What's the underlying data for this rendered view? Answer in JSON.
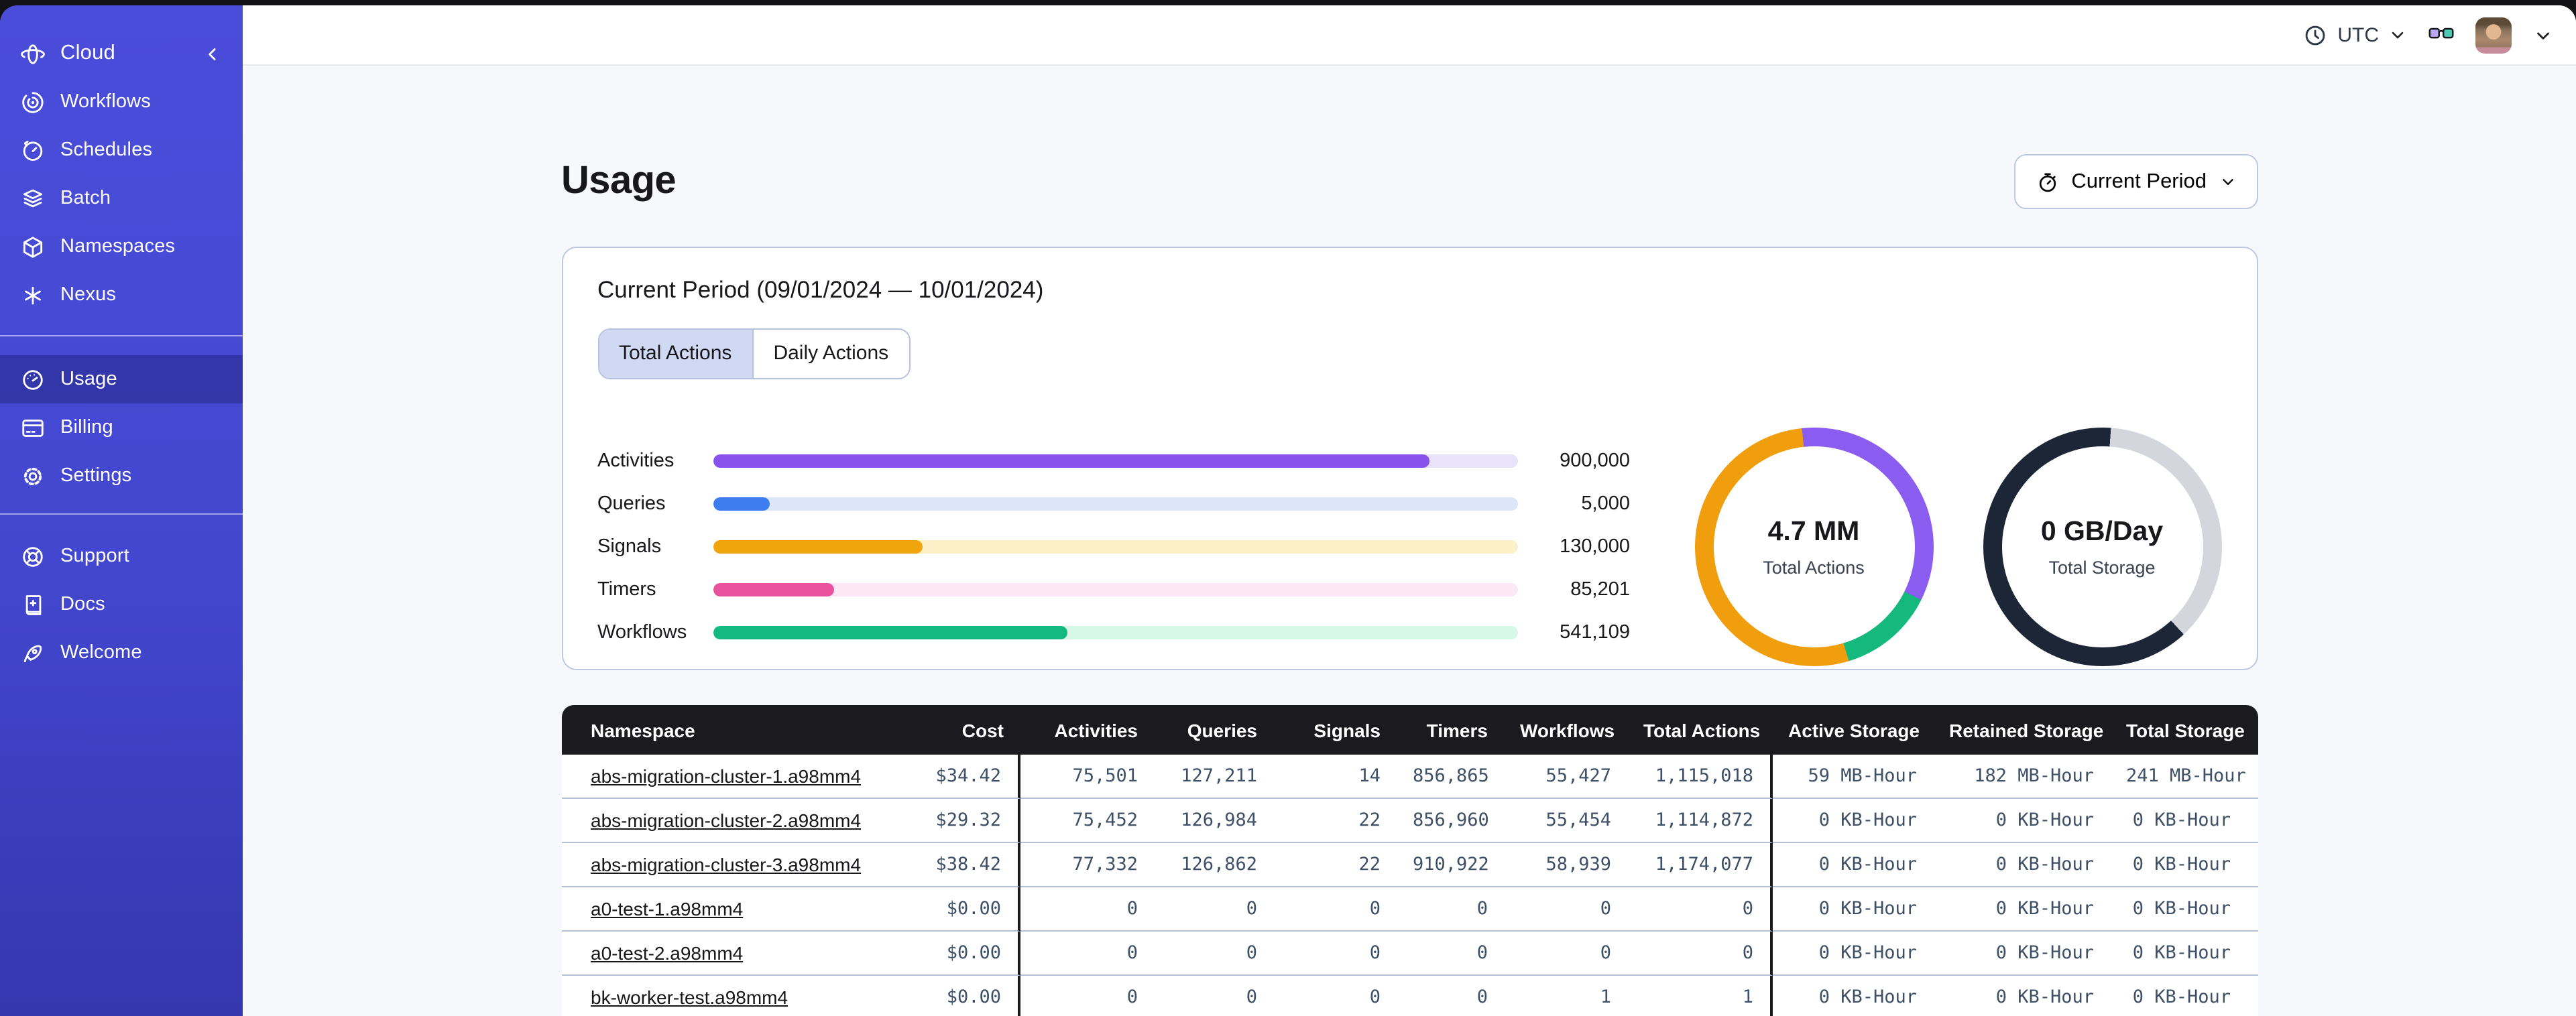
{
  "sidebar": {
    "groups": [
      {
        "divider": "none",
        "items": [
          {
            "icon": "cloud",
            "label": "Cloud",
            "trailing": "chevron-left",
            "active": false,
            "brand": true
          }
        ]
      },
      {
        "divider": "none",
        "items": [
          {
            "icon": "workflows",
            "label": "Workflows",
            "active": false
          },
          {
            "icon": "schedules",
            "label": "Schedules",
            "active": false
          },
          {
            "icon": "batch",
            "label": "Batch",
            "active": false
          },
          {
            "icon": "namespaces",
            "label": "Namespaces",
            "active": false
          },
          {
            "icon": "nexus",
            "label": "Nexus",
            "active": false
          }
        ]
      },
      {
        "divider": "line",
        "items": [
          {
            "icon": "usage",
            "label": "Usage",
            "active": true
          },
          {
            "icon": "billing",
            "label": "Billing",
            "active": false
          },
          {
            "icon": "settings",
            "label": "Settings",
            "active": false
          }
        ]
      },
      {
        "divider": "line",
        "items": [
          {
            "icon": "support",
            "label": "Support",
            "active": false
          },
          {
            "icon": "docs",
            "label": "Docs",
            "active": false
          },
          {
            "icon": "welcome",
            "label": "Welcome",
            "active": false
          }
        ]
      }
    ]
  },
  "topbar": {
    "timezone": "UTC"
  },
  "page": {
    "title": "Usage",
    "period_button_label": "Current Period"
  },
  "usage_card": {
    "title": "Current Period (09/01/2024 — 10/01/2024)",
    "tabs": [
      {
        "label": "Total Actions",
        "active": true
      },
      {
        "label": "Daily Actions",
        "active": false
      }
    ]
  },
  "chart_data": [
    {
      "type": "bar",
      "title": "Total Actions by type",
      "categories": [
        "Activities",
        "Queries",
        "Signals",
        "Timers",
        "Workflows"
      ],
      "values": [
        900000,
        5000,
        130000,
        85201,
        541109
      ],
      "value_labels": [
        "900,000",
        "5,000",
        "130,000",
        "85,201",
        "541,109"
      ],
      "fill_pct": [
        89,
        7,
        26,
        15,
        44
      ],
      "colors": [
        "#8952ef",
        "#3e7df0",
        "#f0a50c",
        "#e9509e",
        "#13b981"
      ],
      "track_colors": [
        "#e8e3fa",
        "#dbe6f9",
        "#fcf0c8",
        "#fbe7f6",
        "#d7f7e7"
      ],
      "legend": "none",
      "grid": "off"
    },
    {
      "type": "pie",
      "center_value": "4.7 MM",
      "center_label": "Total Actions",
      "start_deg": -6,
      "segments": [
        {
          "color": "#8b5cf0",
          "pct": 34
        },
        {
          "color": "#16b97d",
          "pct": 13
        },
        {
          "color": "#f09e0e",
          "pct": 53
        }
      ]
    },
    {
      "type": "pie",
      "center_value": "0 GB/Day",
      "center_label": "Total Storage",
      "start_deg": 4,
      "segments": [
        {
          "color": "#d3d6dd",
          "pct": 37
        },
        {
          "color": "#1c2636",
          "pct": 63
        }
      ]
    }
  ],
  "table": {
    "columns": [
      {
        "key": "namespace",
        "label": "Namespace",
        "align": "left",
        "group_end": false
      },
      {
        "key": "cost",
        "label": "Cost",
        "align": "right",
        "group_end": true
      },
      {
        "key": "activities",
        "label": "Activities",
        "align": "right",
        "group_end": false
      },
      {
        "key": "queries",
        "label": "Queries",
        "align": "right",
        "group_end": false
      },
      {
        "key": "signals",
        "label": "Signals",
        "align": "right",
        "group_end": false
      },
      {
        "key": "timers",
        "label": "Timers",
        "align": "right",
        "group_end": false
      },
      {
        "key": "workflows",
        "label": "Workflows",
        "align": "right",
        "group_end": false
      },
      {
        "key": "total_actions",
        "label": "Total Actions",
        "align": "right",
        "group_end": true
      },
      {
        "key": "active_storage",
        "label": "Active Storage",
        "align": "right",
        "group_end": false
      },
      {
        "key": "retained_storage",
        "label": "Retained Storage",
        "align": "right",
        "group_end": false
      },
      {
        "key": "total_storage",
        "label": "Total Storage",
        "align": "right",
        "group_end": false
      }
    ],
    "rows": [
      {
        "namespace": "abs-migration-cluster-1.a98mm4",
        "cost": "$34.42",
        "activities": "75,501",
        "queries": "127,211",
        "signals": "14",
        "timers": "856,865",
        "workflows": "55,427",
        "total_actions": "1,115,018",
        "active_storage": "59 MB-Hour",
        "retained_storage": "182 MB-Hour",
        "total_storage": "241 MB-Hour"
      },
      {
        "namespace": "abs-migration-cluster-2.a98mm4",
        "cost": "$29.32",
        "activities": "75,452",
        "queries": "126,984",
        "signals": "22",
        "timers": "856,960",
        "workflows": "55,454",
        "total_actions": "1,114,872",
        "active_storage": "0 KB-Hour",
        "retained_storage": "0 KB-Hour",
        "total_storage": "0 KB-Hour"
      },
      {
        "namespace": "abs-migration-cluster-3.a98mm4",
        "cost": "$38.42",
        "activities": "77,332",
        "queries": "126,862",
        "signals": "22",
        "timers": "910,922",
        "workflows": "58,939",
        "total_actions": "1,174,077",
        "active_storage": "0 KB-Hour",
        "retained_storage": "0 KB-Hour",
        "total_storage": "0 KB-Hour"
      },
      {
        "namespace": "a0-test-1.a98mm4",
        "cost": "$0.00",
        "activities": "0",
        "queries": "0",
        "signals": "0",
        "timers": "0",
        "workflows": "0",
        "total_actions": "0",
        "active_storage": "0 KB-Hour",
        "retained_storage": "0 KB-Hour",
        "total_storage": "0 KB-Hour"
      },
      {
        "namespace": "a0-test-2.a98mm4",
        "cost": "$0.00",
        "activities": "0",
        "queries": "0",
        "signals": "0",
        "timers": "0",
        "workflows": "0",
        "total_actions": "0",
        "active_storage": "0 KB-Hour",
        "retained_storage": "0 KB-Hour",
        "total_storage": "0 KB-Hour"
      },
      {
        "namespace": "bk-worker-test.a98mm4",
        "cost": "$0.00",
        "activities": "0",
        "queries": "0",
        "signals": "0",
        "timers": "0",
        "workflows": "1",
        "total_actions": "1",
        "active_storage": "0 KB-Hour",
        "retained_storage": "0 KB-Hour",
        "total_storage": "0 KB-Hour"
      }
    ]
  }
}
